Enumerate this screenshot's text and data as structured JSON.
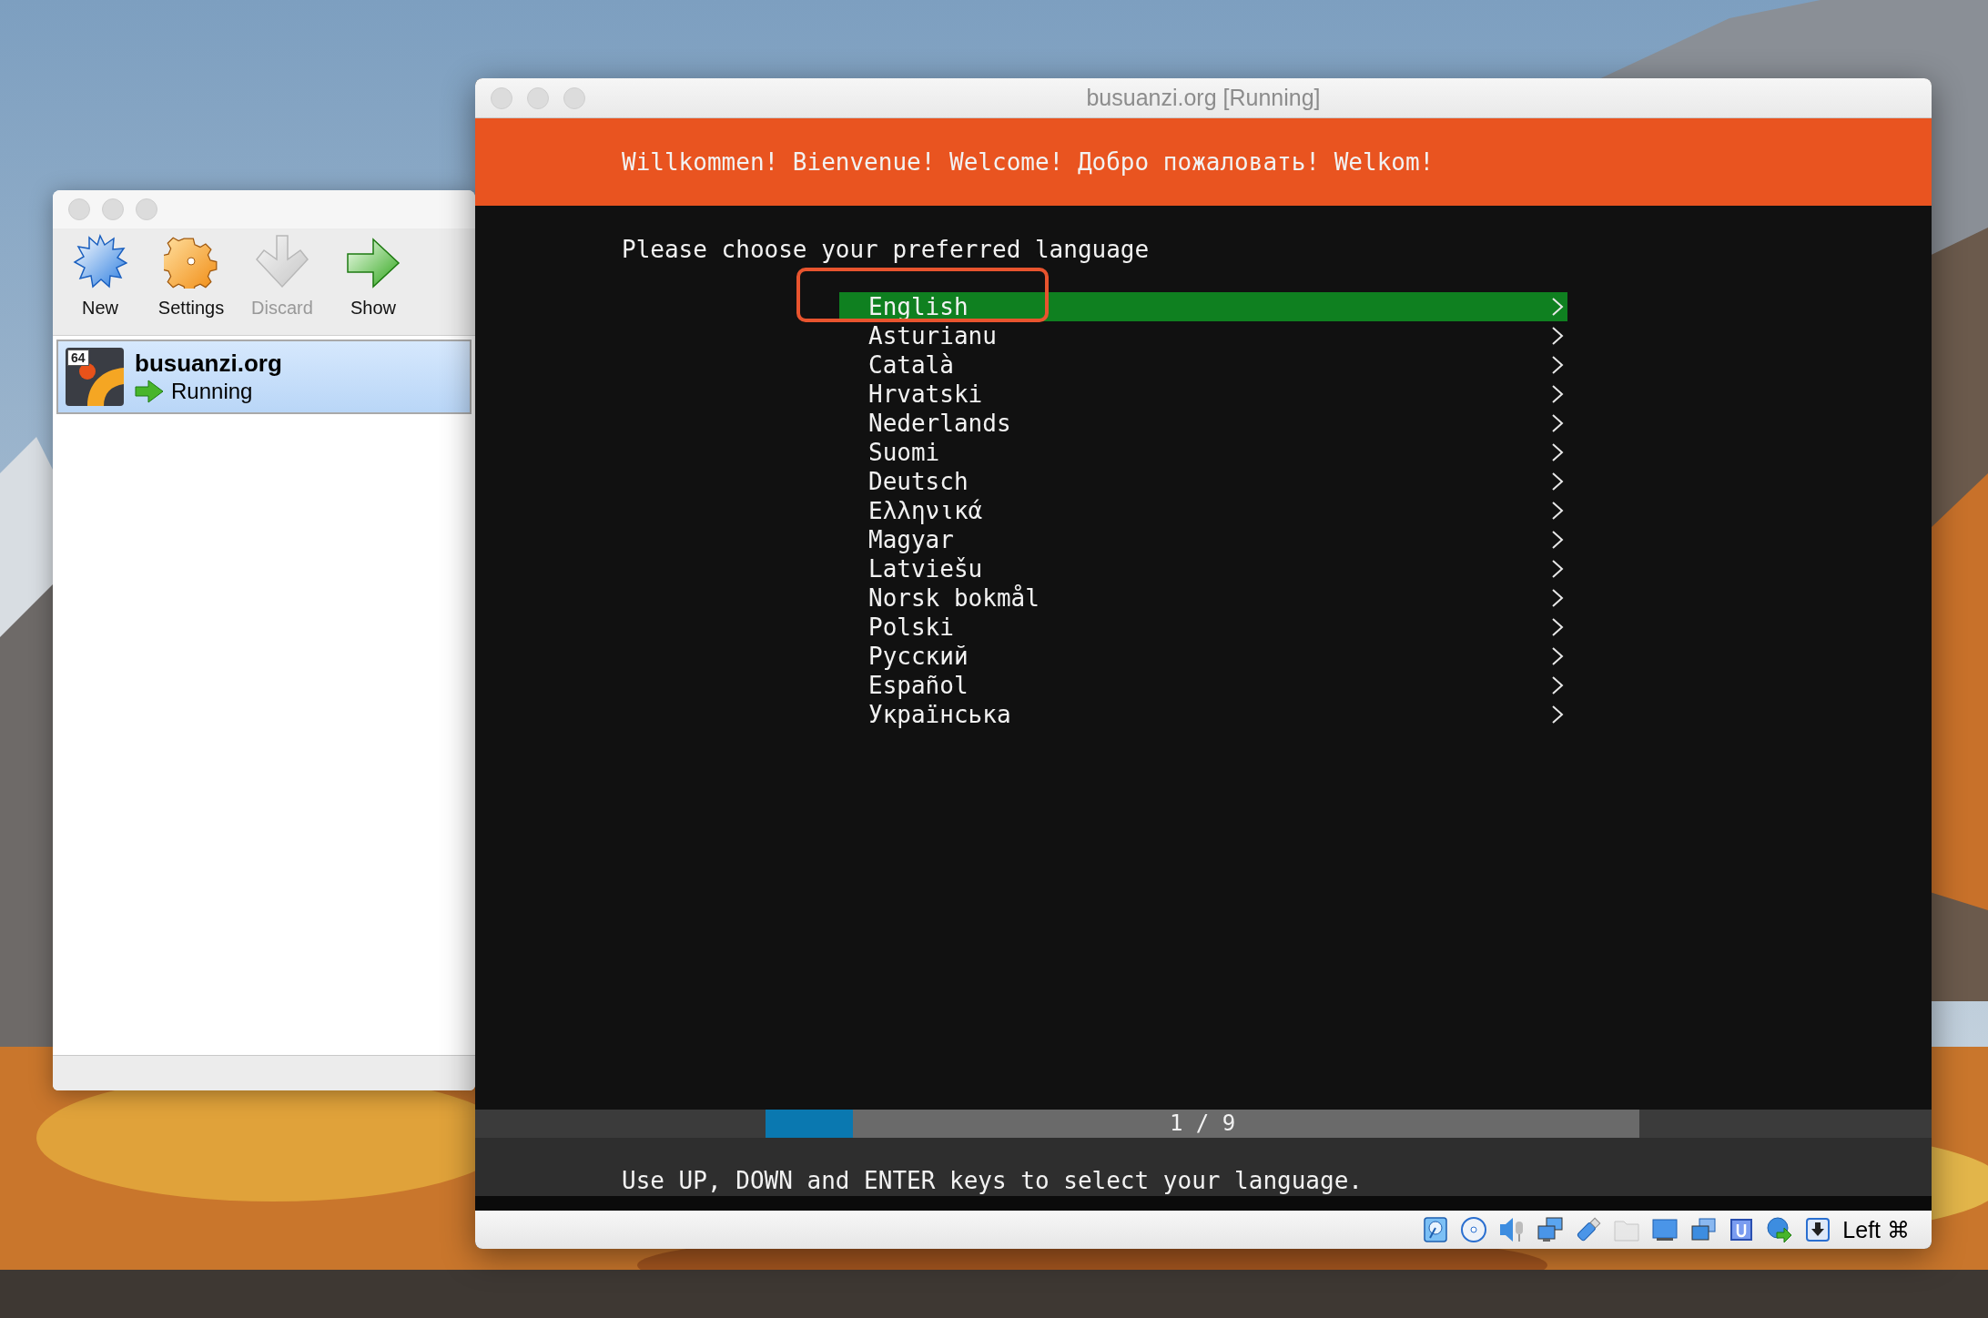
{
  "manager_window": {
    "toolbar": [
      {
        "kind": "new",
        "label": "New",
        "disabled": false
      },
      {
        "kind": "settings",
        "label": "Settings",
        "disabled": false
      },
      {
        "kind": "discard",
        "label": "Discard",
        "disabled": true
      },
      {
        "kind": "show",
        "label": "Show",
        "disabled": false
      }
    ],
    "machines": [
      {
        "badge": "64",
        "name": "busuanzi.org",
        "state": "Running",
        "selected": true
      }
    ]
  },
  "vm_window": {
    "title": "busuanzi.org [Running]",
    "banner": "Willkommen! Bienvenue! Welcome! Добро пожаловать! Welkom!",
    "prompt": "Please choose your preferred language",
    "languages": [
      {
        "label": "English",
        "selected": true
      },
      {
        "label": "Asturianu",
        "selected": false
      },
      {
        "label": "Català",
        "selected": false
      },
      {
        "label": "Hrvatski",
        "selected": false
      },
      {
        "label": "Nederlands",
        "selected": false
      },
      {
        "label": "Suomi",
        "selected": false
      },
      {
        "label": "Deutsch",
        "selected": false
      },
      {
        "label": "Ελληνικά",
        "selected": false
      },
      {
        "label": "Magyar",
        "selected": false
      },
      {
        "label": "Latviešu",
        "selected": false
      },
      {
        "label": "Norsk bokmål",
        "selected": false
      },
      {
        "label": "Polski",
        "selected": false
      },
      {
        "label": "Русский",
        "selected": false
      },
      {
        "label": "Español",
        "selected": false
      },
      {
        "label": "Українська",
        "selected": false
      }
    ],
    "progress": {
      "level": 0.1,
      "label": "1 / 9"
    },
    "hint": "Use UP, DOWN and ENTER keys to select your language.",
    "status_bar": {
      "indicators": [
        {
          "kind": "hard-disk",
          "disabled": false
        },
        {
          "kind": "optical-disc",
          "disabled": false
        },
        {
          "kind": "audio",
          "disabled": false
        },
        {
          "kind": "network",
          "disabled": false
        },
        {
          "kind": "usb",
          "disabled": false
        },
        {
          "kind": "shared-folder",
          "disabled": true
        },
        {
          "kind": "display",
          "disabled": false
        },
        {
          "kind": "recording",
          "disabled": false
        },
        {
          "kind": "cpu",
          "disabled": false
        },
        {
          "kind": "mouse-integration",
          "disabled": false
        },
        {
          "kind": "keyboard-capture",
          "disabled": false
        }
      ],
      "host_key": "Left ⌘"
    }
  },
  "annotation": {
    "kind": "highlight-rectangle"
  }
}
